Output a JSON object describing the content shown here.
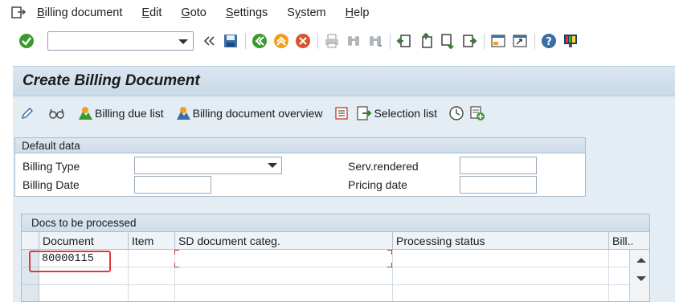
{
  "menu": {
    "items": [
      {
        "label": "Billing document",
        "accel": "B",
        "rest": "illing document"
      },
      {
        "label": "Edit",
        "accel": "E",
        "rest": "dit"
      },
      {
        "label": "Goto",
        "accel": "G",
        "rest": "oto"
      },
      {
        "label": "Settings",
        "accel": "S",
        "rest": "ettings"
      },
      {
        "label": "System",
        "accel": "y",
        "pre": "S",
        "rest": "stem"
      },
      {
        "label": "Help",
        "accel": "H",
        "rest": "elp"
      }
    ]
  },
  "toolbar": {
    "command_value": "",
    "icons": [
      "enter-icon",
      "save-icon",
      "back-icon",
      "exit-icon",
      "cancel-icon",
      "print-icon",
      "find-icon",
      "find-next-icon",
      "first-page-icon",
      "prev-page-icon",
      "next-page-icon",
      "last-page-icon",
      "new-session-icon",
      "shortcut-icon",
      "help-icon",
      "customize-layout-icon"
    ]
  },
  "title": "Create Billing Document",
  "app_toolbar": {
    "billing_due_list": "Billing due list",
    "billing_doc_overview": "Billing document overview",
    "selection_list": "Selection list"
  },
  "default_data": {
    "header": "Default data",
    "billing_type_label": "Billing Type",
    "billing_type_value": "",
    "billing_date_label": "Billing Date",
    "billing_date_value": "",
    "serv_rendered_label": "Serv.rendered",
    "serv_rendered_value": "",
    "pricing_date_label": "Pricing date",
    "pricing_date_value": ""
  },
  "docs_table": {
    "header": "Docs to be processed",
    "columns": [
      "Document",
      "Item",
      "SD document categ.",
      "Processing status",
      "Bill..."
    ],
    "rows": [
      {
        "document": "80000115",
        "item": "",
        "sd_categ": "",
        "status": "",
        "bill": ""
      },
      {
        "document": "",
        "item": "",
        "sd_categ": "",
        "status": "",
        "bill": ""
      },
      {
        "document": "",
        "item": "",
        "sd_categ": "",
        "status": "",
        "bill": ""
      }
    ]
  },
  "colors": {
    "accent_green": "#3a9a2e",
    "highlight_red": "#e0393b",
    "header_blue": "#dbe7f1"
  }
}
